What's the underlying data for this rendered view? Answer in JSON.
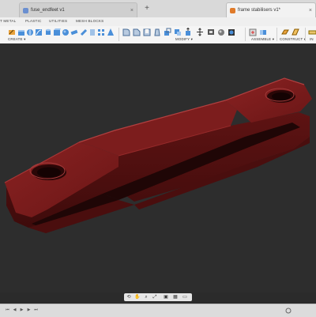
{
  "tabs": [
    {
      "label": "fuse_endfeet v1",
      "icon": "part-icon"
    },
    {
      "label": "frame stabilisers v1*",
      "icon": "part-icon"
    }
  ],
  "tab_add_label": "+",
  "tab_close_label": "×",
  "subtabs": [
    "T METAL",
    "PLASTIC",
    "UTILITIES",
    "MESH BLOCKS"
  ],
  "toolbar_groups": {
    "create": "CREATE ▾",
    "modify": "MODIFY ▾",
    "assemble": "ASSEMBLE ▾",
    "construct": "CONSTRUCT ▾",
    "inspect": "IN"
  },
  "model": {
    "name": "frame stabiliser bracket",
    "color": "#7a1a1a"
  },
  "navbar_icons": [
    "orbit-icon",
    "pan-icon",
    "zoom-icon",
    "fit-icon",
    "display-icon",
    "grid-icon",
    "viewport-icon"
  ],
  "timeline_icons": [
    "first-icon",
    "prev-icon",
    "play-icon",
    "next-icon",
    "last-icon"
  ],
  "colors": {
    "viewport_bg": "#2d2d2d",
    "accent": "#1a5fb4",
    "part_orange": "#e07b2a"
  }
}
